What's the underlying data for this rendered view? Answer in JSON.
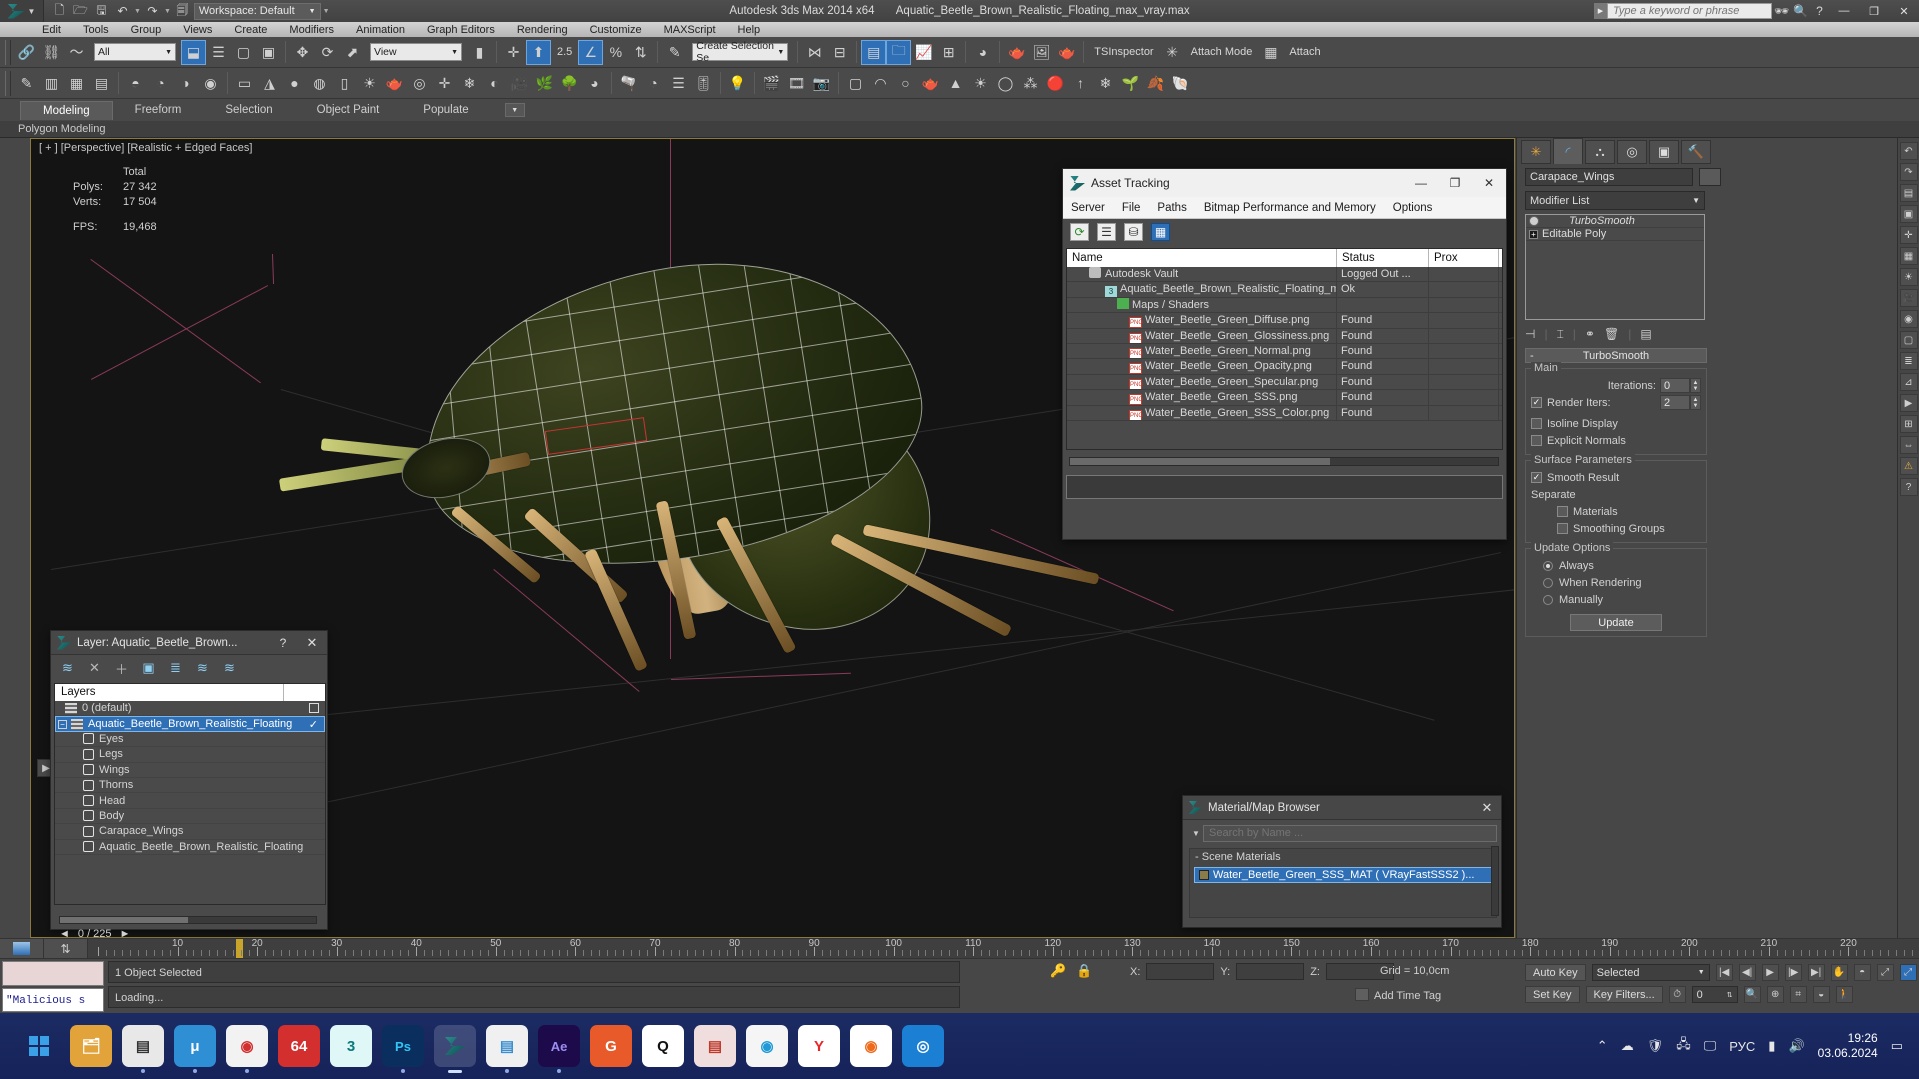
{
  "titlebar": {
    "workspace_label": "Workspace: Default",
    "app_title": "Autodesk 3ds Max  2014 x64",
    "file_title": "Aquatic_Beetle_Brown_Realistic_Floating_max_vray.max",
    "search_placeholder": "Type a keyword or phrase",
    "minimize": "—",
    "maximize": "❐",
    "close": "✕"
  },
  "menubar": {
    "items": [
      "Edit",
      "Tools",
      "Group",
      "Views",
      "Create",
      "Modifiers",
      "Animation",
      "Graph Editors",
      "Rendering",
      "Customize",
      "MAXScript",
      "Help"
    ]
  },
  "toolbar": {
    "selection_filter": "All",
    "reference_coord": "View",
    "named_selection_set": "Create Selection Se",
    "percent_snap_label": "2.5",
    "tsinspector_label": "TSInspector",
    "attach_mode_label": "Attach Mode",
    "attach_label": "Attach"
  },
  "ribbon": {
    "tabs": [
      "Modeling",
      "Freeform",
      "Selection",
      "Object Paint",
      "Populate"
    ],
    "active_tab": "Modeling",
    "subtitle": "Polygon Modeling"
  },
  "viewport": {
    "label": "[ + ] [Perspective] [Realistic + Edged Faces]",
    "stats": {
      "total_header": "Total",
      "rows": [
        {
          "label": "Polys:",
          "value": "27 342"
        },
        {
          "label": "Verts:",
          "value": "17 504"
        },
        {
          "label": "FPS:",
          "value": "19,468"
        }
      ]
    }
  },
  "asset_tracking": {
    "title": "Asset Tracking",
    "menu": [
      "Server",
      "File",
      "Paths",
      "Bitmap Performance and Memory",
      "Options"
    ],
    "toolbar_icons": [
      "refresh-icon",
      "list-icon",
      "path-icon",
      "table-icon"
    ],
    "columns": [
      "Name",
      "Status",
      "Prox"
    ],
    "rows": [
      {
        "icon": "vault-icon",
        "indent": 1,
        "name": "Autodesk Vault",
        "status": "Logged Out ...",
        "prox": ""
      },
      {
        "icon": "max-icon",
        "indent": 2,
        "name": "Aquatic_Beetle_Brown_Realistic_Floating_max_vr...",
        "status": "Ok",
        "prox": ""
      },
      {
        "icon": "map-icon",
        "indent": 3,
        "name": "Maps / Shaders",
        "status": "",
        "prox": ""
      },
      {
        "icon": "png-icon",
        "indent": 4,
        "name": "Water_Beetle_Green_Diffuse.png",
        "status": "Found",
        "prox": ""
      },
      {
        "icon": "png-icon",
        "indent": 4,
        "name": "Water_Beetle_Green_Glossiness.png",
        "status": "Found",
        "prox": ""
      },
      {
        "icon": "png-icon",
        "indent": 4,
        "name": "Water_Beetle_Green_Normal.png",
        "status": "Found",
        "prox": ""
      },
      {
        "icon": "png-icon",
        "indent": 4,
        "name": "Water_Beetle_Green_Opacity.png",
        "status": "Found",
        "prox": ""
      },
      {
        "icon": "png-icon",
        "indent": 4,
        "name": "Water_Beetle_Green_Specular.png",
        "status": "Found",
        "prox": ""
      },
      {
        "icon": "png-icon",
        "indent": 4,
        "name": "Water_Beetle_Green_SSS.png",
        "status": "Found",
        "prox": ""
      },
      {
        "icon": "png-icon",
        "indent": 4,
        "name": "Water_Beetle_Green_SSS_Color.png",
        "status": "Found",
        "prox": ""
      }
    ]
  },
  "layer_dialog": {
    "title": "Layer: Aquatic_Beetle_Brown...",
    "help_glyph": "?",
    "close_glyph": "✕",
    "column_header": "Layers",
    "rows": [
      {
        "type": "layer",
        "name": "0 (default)",
        "selected": false,
        "marker": "square"
      },
      {
        "type": "layer",
        "name": "Aquatic_Beetle_Brown_Realistic_Floating",
        "selected": true,
        "marker": "check",
        "expander": "-"
      },
      {
        "type": "object",
        "name": "Eyes",
        "selected": false
      },
      {
        "type": "object",
        "name": "Legs",
        "selected": false
      },
      {
        "type": "object",
        "name": "Wings",
        "selected": false
      },
      {
        "type": "object",
        "name": "Thorns",
        "selected": false
      },
      {
        "type": "object",
        "name": "Head",
        "selected": false
      },
      {
        "type": "object",
        "name": "Body",
        "selected": false
      },
      {
        "type": "object",
        "name": "Carapace_Wings",
        "selected": false
      },
      {
        "type": "object",
        "name": "Aquatic_Beetle_Brown_Realistic_Floating",
        "selected": false
      }
    ],
    "counter": "0 / 225"
  },
  "material_browser": {
    "title": "Material/Map Browser",
    "close_glyph": "✕",
    "search_placeholder": "Search by Name ...",
    "group_label": "Scene Materials",
    "items": [
      {
        "name": "Water_Beetle_Green_SSS_MAT  ( VRayFastSSS2 )..."
      }
    ]
  },
  "command_panel": {
    "tabs": [
      "create-icon",
      "modify-icon",
      "hierarchy-icon",
      "motion-icon",
      "display-icon",
      "utilities-icon"
    ],
    "active_tab_index": 1,
    "object_name": "Carapace_Wings",
    "modifier_list_label": "Modifier List",
    "stack": [
      {
        "name": "TurboSmooth",
        "italic": true,
        "icon": "lightbulb-icon"
      },
      {
        "name": "Editable Poly",
        "italic": false,
        "icon": "plus-icon"
      }
    ],
    "rollout": {
      "title": "TurboSmooth",
      "collapse_glyph": "-",
      "main_group": "Main",
      "iterations_label": "Iterations:",
      "iterations_value": "0",
      "render_iters_label": "Render Iters:",
      "render_iters_value": "2",
      "render_iters_checked": true,
      "isoline_label": "Isoline Display",
      "isoline_checked": false,
      "explicit_normals_label": "Explicit Normals",
      "explicit_normals_checked": false,
      "surface_group": "Surface Parameters",
      "smooth_result_label": "Smooth Result",
      "smooth_result_checked": true,
      "separate_label": "Separate",
      "materials_label": "Materials",
      "materials_checked": false,
      "smoothing_groups_label": "Smoothing Groups",
      "smoothing_groups_checked": false,
      "update_group": "Update Options",
      "always_label": "Always",
      "when_rendering_label": "When Rendering",
      "manually_label": "Manually",
      "selected_update": "Always",
      "update_button": "Update"
    }
  },
  "timeline": {
    "ticks": [
      10,
      20,
      30,
      40,
      50,
      60,
      70,
      80,
      90,
      100,
      110,
      120,
      130,
      140,
      150,
      160,
      170,
      180,
      190,
      200,
      210,
      220
    ]
  },
  "statusbar": {
    "script_text": "\"Malicious s",
    "selection_status": "1 Object Selected",
    "prompt": "Loading...",
    "x_label": "X:",
    "x_value": "",
    "y_label": "Y:",
    "y_value": "",
    "z_label": "Z:",
    "z_value": "",
    "grid_text": "Grid = 10,0cm",
    "add_time_tag": "Add Time Tag",
    "auto_key": "Auto Key",
    "set_key": "Set Key",
    "key_selection": "Selected",
    "key_filters": "Key Filters...",
    "frame_value": "0"
  },
  "taskbar": {
    "apps": [
      {
        "name": "start-icon",
        "glyph": "",
        "color": "#0a4b8c"
      },
      {
        "name": "file-explorer-icon",
        "glyph": "🗂",
        "color": "#e2a33a"
      },
      {
        "name": "calculator-icon",
        "glyph": "▤",
        "color": "#dcdcdc"
      },
      {
        "name": "utorrent-icon",
        "glyph": "μ",
        "color": "#2f8fd4"
      },
      {
        "name": "chrome-icon",
        "glyph": "◉",
        "color": "#f0b400"
      },
      {
        "name": "64-app-icon",
        "glyph": "64",
        "color": "#d32f2f"
      },
      {
        "name": "3dsmax-2014-icon",
        "glyph": "3",
        "color": "#17b2b2"
      },
      {
        "name": "photoshop-icon",
        "glyph": "Ps",
        "color": "#0a2f5e"
      },
      {
        "name": "3dsmax-active-icon",
        "glyph": "",
        "color": "#0e5a5a"
      },
      {
        "name": "notepad-icon",
        "glyph": "▤",
        "color": "#4aa8d8"
      },
      {
        "name": "after-effects-icon",
        "glyph": "Ae",
        "color": "#1d0a4a"
      },
      {
        "name": "opera-gx-icon",
        "glyph": "G",
        "color": "#e85a2a"
      },
      {
        "name": "search-app-icon",
        "glyph": "Q",
        "color": "#ffffff"
      },
      {
        "name": "save-disk-icon",
        "glyph": "▤",
        "color": "#e8b0b0"
      },
      {
        "name": "edge-icon",
        "glyph": "◉",
        "color": "#1f9ad6"
      },
      {
        "name": "yandex-icon",
        "glyph": "Y",
        "color": "#ffffff"
      },
      {
        "name": "orange-circle-icon",
        "glyph": "◉",
        "color": "#f06a1a"
      },
      {
        "name": "blue-app-icon",
        "glyph": "◎",
        "color": "#1b7fd4"
      }
    ],
    "tray": [
      "chevron-up-icon",
      "cloud-icon",
      "shield-icon",
      "usb-icon",
      "monitor-icon",
      "network-icon",
      "volume-icon"
    ],
    "lang": "РУС",
    "time": "19:26",
    "date": "03.06.2024"
  }
}
